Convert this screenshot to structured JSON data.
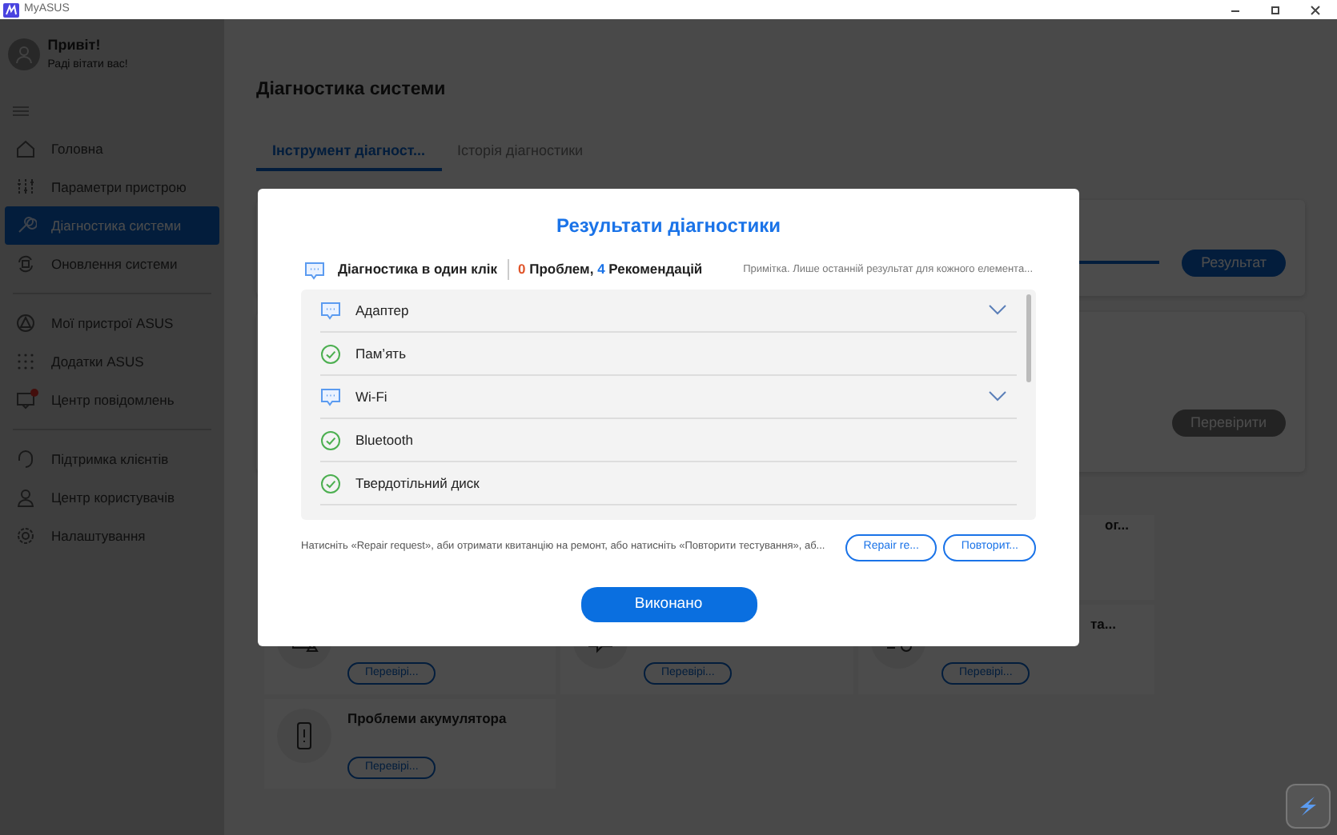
{
  "window": {
    "title": "MyASUS"
  },
  "user": {
    "greeting": "Привіт!",
    "subtitle": "Раді вітати вас!"
  },
  "sidebar": {
    "groups": [
      [
        {
          "label": "Головна",
          "selected": false,
          "alert": false
        },
        {
          "label": "Параметри пристрою",
          "selected": false,
          "alert": false
        },
        {
          "label": "Діагностика системи",
          "selected": true,
          "alert": false
        },
        {
          "label": "Оновлення системи",
          "selected": false,
          "alert": false
        }
      ],
      [
        {
          "label": "Мої пристрої ASUS",
          "selected": false,
          "alert": false
        },
        {
          "label": "Додатки ASUS",
          "selected": false,
          "alert": false
        },
        {
          "label": "Центр повідомлень",
          "selected": false,
          "alert": true
        }
      ],
      [
        {
          "label": "Підтримка клієнтів",
          "selected": false,
          "alert": false
        },
        {
          "label": "Центр користувачів",
          "selected": false,
          "alert": false
        },
        {
          "label": "Налаштування",
          "selected": false,
          "alert": false
        }
      ]
    ]
  },
  "page": {
    "title": "Діагностика системи",
    "tabs": [
      {
        "label": "Інструмент діагност...",
        "selected": true
      },
      {
        "label": "Історія діагностики",
        "selected": false
      }
    ],
    "scan_card": {
      "level": 1,
      "button": "Результат"
    },
    "check_card": {
      "button": "Перевірити",
      "disabled": true
    },
    "test_rows": [
      [
        {},
        {},
        {
          "title": "ог..."
        }
      ],
      [
        {
          "button": "Перевірі..."
        },
        {
          "button": "Перевірі..."
        },
        {
          "title": "та...",
          "button": "Перевірі..."
        }
      ],
      [
        {
          "title": "Проблеми акумулятора",
          "button": "Перевірі..."
        }
      ]
    ]
  },
  "dialog": {
    "title": "Результати діагностики",
    "summary": {
      "label": "Діагностика в один клік",
      "problems_count": "0",
      "problems_label": "Проблем,",
      "recommendations_count": "4",
      "recommendations_label": "Рекомендацій"
    },
    "note": "Примітка. Лише останній результат для кожного елемента...",
    "results": [
      {
        "kind": "recommendation",
        "label": "Адаптер",
        "expanded": false
      },
      {
        "kind": "ok",
        "label": "Пам’ять"
      },
      {
        "kind": "recommendation",
        "label": "Wi-Fi",
        "expanded": false
      },
      {
        "kind": "ok",
        "label": "Bluetooth"
      },
      {
        "kind": "ok",
        "label": "Твердотільний диск"
      }
    ],
    "hint": "Натисніть «Repair request», аби отримати квитанцію на ремонт, або натисніть «Повторити тестування», аб...",
    "buttons": [
      {
        "kind": "outline",
        "label": "Repair re..."
      },
      {
        "kind": "outline",
        "label": "Повторит..."
      },
      {
        "kind": "primary",
        "label": "Виконано"
      }
    ]
  }
}
